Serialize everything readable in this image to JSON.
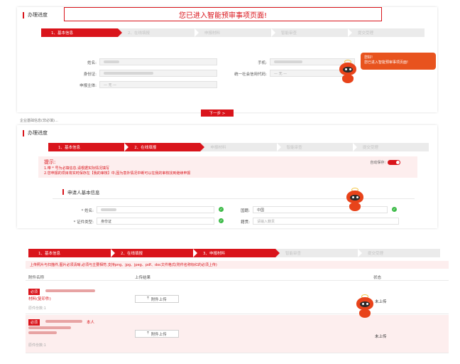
{
  "banner": {
    "text": "您已进入智能预审事项页面!"
  },
  "section1": {
    "title": "办理进度",
    "steps": [
      "1、基本信息",
      "2、在线填报",
      "申报材料",
      "智能审查",
      "提交受理"
    ],
    "fields": {
      "name_label": "姓名:",
      "phone_label": "手机:",
      "id_label": "身份证:",
      "credit_code_label": "统一社会信用代码:",
      "credit_code_placeholder": "— 无 —",
      "subject_label": "申报主体:",
      "subject_placeholder": "— 无 —"
    },
    "next_button": "下一步 >",
    "stray_text": "企业基础信息(非必填)…"
  },
  "assistant_bubble": {
    "line1": "您好!",
    "line2": "您已进入智能预审事项页面!"
  },
  "section2": {
    "title": "办理进度",
    "steps": [
      "1、基本信息",
      "2、在线填报",
      "申报材料",
      "智能审查",
      "提交受理"
    ],
    "tip_title": "提示:",
    "tip_line1": "1.带 * 号为必填信息,请根据实际情况填写",
    "tip_line2": "2.您申报的项目将实时保存在【我的审核】中,因为意外情况中断可以在我的审核找到继续申报",
    "autosave_label": "自动保存:",
    "applicant_title": "申请人基本信息",
    "name_label": "* 姓名:",
    "nationality_label": "国籍:",
    "nationality_value": "中国",
    "id_type_label": "* 证件类型:",
    "id_type_value": "身份证",
    "place_label": "籍贯:",
    "place_placeholder": "请输入籍贯"
  },
  "section3": {
    "steps": [
      "1、基本信息",
      "2、在线填报",
      "3、申报材料",
      "智能审查",
      "提交受理"
    ],
    "upload_notice": "上传照片与扫描件,图片必须清晰,必须与主要相符,支持png、jpg、jpeg、pdf、doc文件格式(附件名称标红的必须上传)",
    "columns": [
      "附件名称",
      "上传结果",
      "状态"
    ],
    "rows": [
      {
        "badge": "必须",
        "file_name": "材料(复印件)",
        "example": "原件份数:1",
        "upload_label": "附件上传",
        "status": "未上传"
      },
      {
        "badge": "必须",
        "file_name": "本人",
        "example": "原件份数:1",
        "upload_label": "附件上传",
        "status": "未上传"
      }
    ]
  },
  "colors": {
    "accent": "#d9141b",
    "mascot": "#e8431a",
    "bubble": "#e8531e"
  },
  "icons": {
    "check": "check-icon",
    "upload": "upload-icon",
    "mascot": "robot-mascot-icon"
  }
}
